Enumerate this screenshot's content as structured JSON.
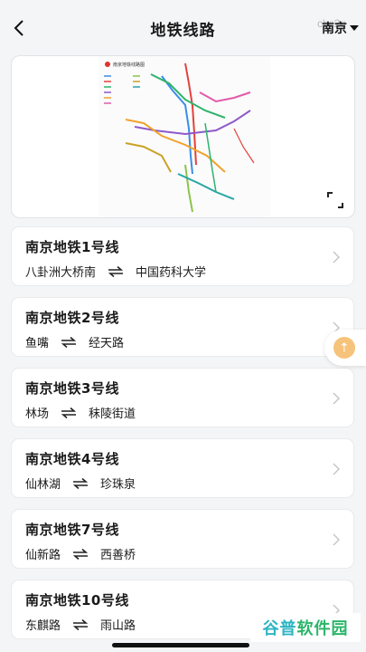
{
  "header": {
    "title": "地铁线路",
    "city": "南京",
    "watermark": "cbc2g"
  },
  "map": {
    "legend_title": "南京地铁线路图"
  },
  "lines": [
    {
      "name": "南京地铁1号线",
      "from": "八卦洲大桥南",
      "to": "中国药科大学"
    },
    {
      "name": "南京地铁2号线",
      "from": "鱼嘴",
      "to": "经天路"
    },
    {
      "name": "南京地铁3号线",
      "from": "林场",
      "to": "秣陵街道"
    },
    {
      "name": "南京地铁4号线",
      "from": "仙林湖",
      "to": "珍珠泉"
    },
    {
      "name": "南京地铁7号线",
      "from": "仙新路",
      "to": "西善桥"
    },
    {
      "name": "南京地铁10号线",
      "from": "东麒路",
      "to": "雨山路"
    }
  ],
  "float_button": {
    "label": "⇡"
  },
  "watermark_logo": {
    "part1": "谷普",
    "part2": "软件园"
  },
  "colors": {
    "accent": "#f6c37a",
    "card_bg": "#ffffff",
    "page_bg": "#f4f5f7"
  }
}
